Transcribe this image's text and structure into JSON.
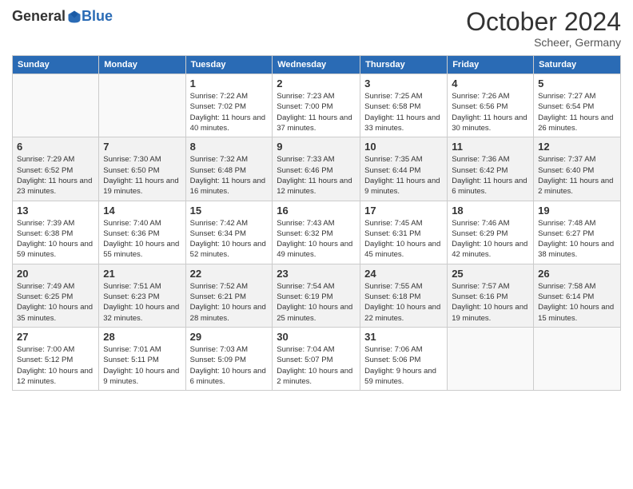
{
  "logo": {
    "general": "General",
    "blue": "Blue"
  },
  "header": {
    "month": "October 2024",
    "location": "Scheer, Germany"
  },
  "weekdays": [
    "Sunday",
    "Monday",
    "Tuesday",
    "Wednesday",
    "Thursday",
    "Friday",
    "Saturday"
  ],
  "weeks": [
    [
      {
        "day": "",
        "sunrise": "",
        "sunset": "",
        "daylight": ""
      },
      {
        "day": "",
        "sunrise": "",
        "sunset": "",
        "daylight": ""
      },
      {
        "day": "1",
        "sunrise": "Sunrise: 7:22 AM",
        "sunset": "Sunset: 7:02 PM",
        "daylight": "Daylight: 11 hours and 40 minutes."
      },
      {
        "day": "2",
        "sunrise": "Sunrise: 7:23 AM",
        "sunset": "Sunset: 7:00 PM",
        "daylight": "Daylight: 11 hours and 37 minutes."
      },
      {
        "day": "3",
        "sunrise": "Sunrise: 7:25 AM",
        "sunset": "Sunset: 6:58 PM",
        "daylight": "Daylight: 11 hours and 33 minutes."
      },
      {
        "day": "4",
        "sunrise": "Sunrise: 7:26 AM",
        "sunset": "Sunset: 6:56 PM",
        "daylight": "Daylight: 11 hours and 30 minutes."
      },
      {
        "day": "5",
        "sunrise": "Sunrise: 7:27 AM",
        "sunset": "Sunset: 6:54 PM",
        "daylight": "Daylight: 11 hours and 26 minutes."
      }
    ],
    [
      {
        "day": "6",
        "sunrise": "Sunrise: 7:29 AM",
        "sunset": "Sunset: 6:52 PM",
        "daylight": "Daylight: 11 hours and 23 minutes."
      },
      {
        "day": "7",
        "sunrise": "Sunrise: 7:30 AM",
        "sunset": "Sunset: 6:50 PM",
        "daylight": "Daylight: 11 hours and 19 minutes."
      },
      {
        "day": "8",
        "sunrise": "Sunrise: 7:32 AM",
        "sunset": "Sunset: 6:48 PM",
        "daylight": "Daylight: 11 hours and 16 minutes."
      },
      {
        "day": "9",
        "sunrise": "Sunrise: 7:33 AM",
        "sunset": "Sunset: 6:46 PM",
        "daylight": "Daylight: 11 hours and 12 minutes."
      },
      {
        "day": "10",
        "sunrise": "Sunrise: 7:35 AM",
        "sunset": "Sunset: 6:44 PM",
        "daylight": "Daylight: 11 hours and 9 minutes."
      },
      {
        "day": "11",
        "sunrise": "Sunrise: 7:36 AM",
        "sunset": "Sunset: 6:42 PM",
        "daylight": "Daylight: 11 hours and 6 minutes."
      },
      {
        "day": "12",
        "sunrise": "Sunrise: 7:37 AM",
        "sunset": "Sunset: 6:40 PM",
        "daylight": "Daylight: 11 hours and 2 minutes."
      }
    ],
    [
      {
        "day": "13",
        "sunrise": "Sunrise: 7:39 AM",
        "sunset": "Sunset: 6:38 PM",
        "daylight": "Daylight: 10 hours and 59 minutes."
      },
      {
        "day": "14",
        "sunrise": "Sunrise: 7:40 AM",
        "sunset": "Sunset: 6:36 PM",
        "daylight": "Daylight: 10 hours and 55 minutes."
      },
      {
        "day": "15",
        "sunrise": "Sunrise: 7:42 AM",
        "sunset": "Sunset: 6:34 PM",
        "daylight": "Daylight: 10 hours and 52 minutes."
      },
      {
        "day": "16",
        "sunrise": "Sunrise: 7:43 AM",
        "sunset": "Sunset: 6:32 PM",
        "daylight": "Daylight: 10 hours and 49 minutes."
      },
      {
        "day": "17",
        "sunrise": "Sunrise: 7:45 AM",
        "sunset": "Sunset: 6:31 PM",
        "daylight": "Daylight: 10 hours and 45 minutes."
      },
      {
        "day": "18",
        "sunrise": "Sunrise: 7:46 AM",
        "sunset": "Sunset: 6:29 PM",
        "daylight": "Daylight: 10 hours and 42 minutes."
      },
      {
        "day": "19",
        "sunrise": "Sunrise: 7:48 AM",
        "sunset": "Sunset: 6:27 PM",
        "daylight": "Daylight: 10 hours and 38 minutes."
      }
    ],
    [
      {
        "day": "20",
        "sunrise": "Sunrise: 7:49 AM",
        "sunset": "Sunset: 6:25 PM",
        "daylight": "Daylight: 10 hours and 35 minutes."
      },
      {
        "day": "21",
        "sunrise": "Sunrise: 7:51 AM",
        "sunset": "Sunset: 6:23 PM",
        "daylight": "Daylight: 10 hours and 32 minutes."
      },
      {
        "day": "22",
        "sunrise": "Sunrise: 7:52 AM",
        "sunset": "Sunset: 6:21 PM",
        "daylight": "Daylight: 10 hours and 28 minutes."
      },
      {
        "day": "23",
        "sunrise": "Sunrise: 7:54 AM",
        "sunset": "Sunset: 6:19 PM",
        "daylight": "Daylight: 10 hours and 25 minutes."
      },
      {
        "day": "24",
        "sunrise": "Sunrise: 7:55 AM",
        "sunset": "Sunset: 6:18 PM",
        "daylight": "Daylight: 10 hours and 22 minutes."
      },
      {
        "day": "25",
        "sunrise": "Sunrise: 7:57 AM",
        "sunset": "Sunset: 6:16 PM",
        "daylight": "Daylight: 10 hours and 19 minutes."
      },
      {
        "day": "26",
        "sunrise": "Sunrise: 7:58 AM",
        "sunset": "Sunset: 6:14 PM",
        "daylight": "Daylight: 10 hours and 15 minutes."
      }
    ],
    [
      {
        "day": "27",
        "sunrise": "Sunrise: 7:00 AM",
        "sunset": "Sunset: 5:12 PM",
        "daylight": "Daylight: 10 hours and 12 minutes."
      },
      {
        "day": "28",
        "sunrise": "Sunrise: 7:01 AM",
        "sunset": "Sunset: 5:11 PM",
        "daylight": "Daylight: 10 hours and 9 minutes."
      },
      {
        "day": "29",
        "sunrise": "Sunrise: 7:03 AM",
        "sunset": "Sunset: 5:09 PM",
        "daylight": "Daylight: 10 hours and 6 minutes."
      },
      {
        "day": "30",
        "sunrise": "Sunrise: 7:04 AM",
        "sunset": "Sunset: 5:07 PM",
        "daylight": "Daylight: 10 hours and 2 minutes."
      },
      {
        "day": "31",
        "sunrise": "Sunrise: 7:06 AM",
        "sunset": "Sunset: 5:06 PM",
        "daylight": "Daylight: 9 hours and 59 minutes."
      },
      {
        "day": "",
        "sunrise": "",
        "sunset": "",
        "daylight": ""
      },
      {
        "day": "",
        "sunrise": "",
        "sunset": "",
        "daylight": ""
      }
    ]
  ]
}
